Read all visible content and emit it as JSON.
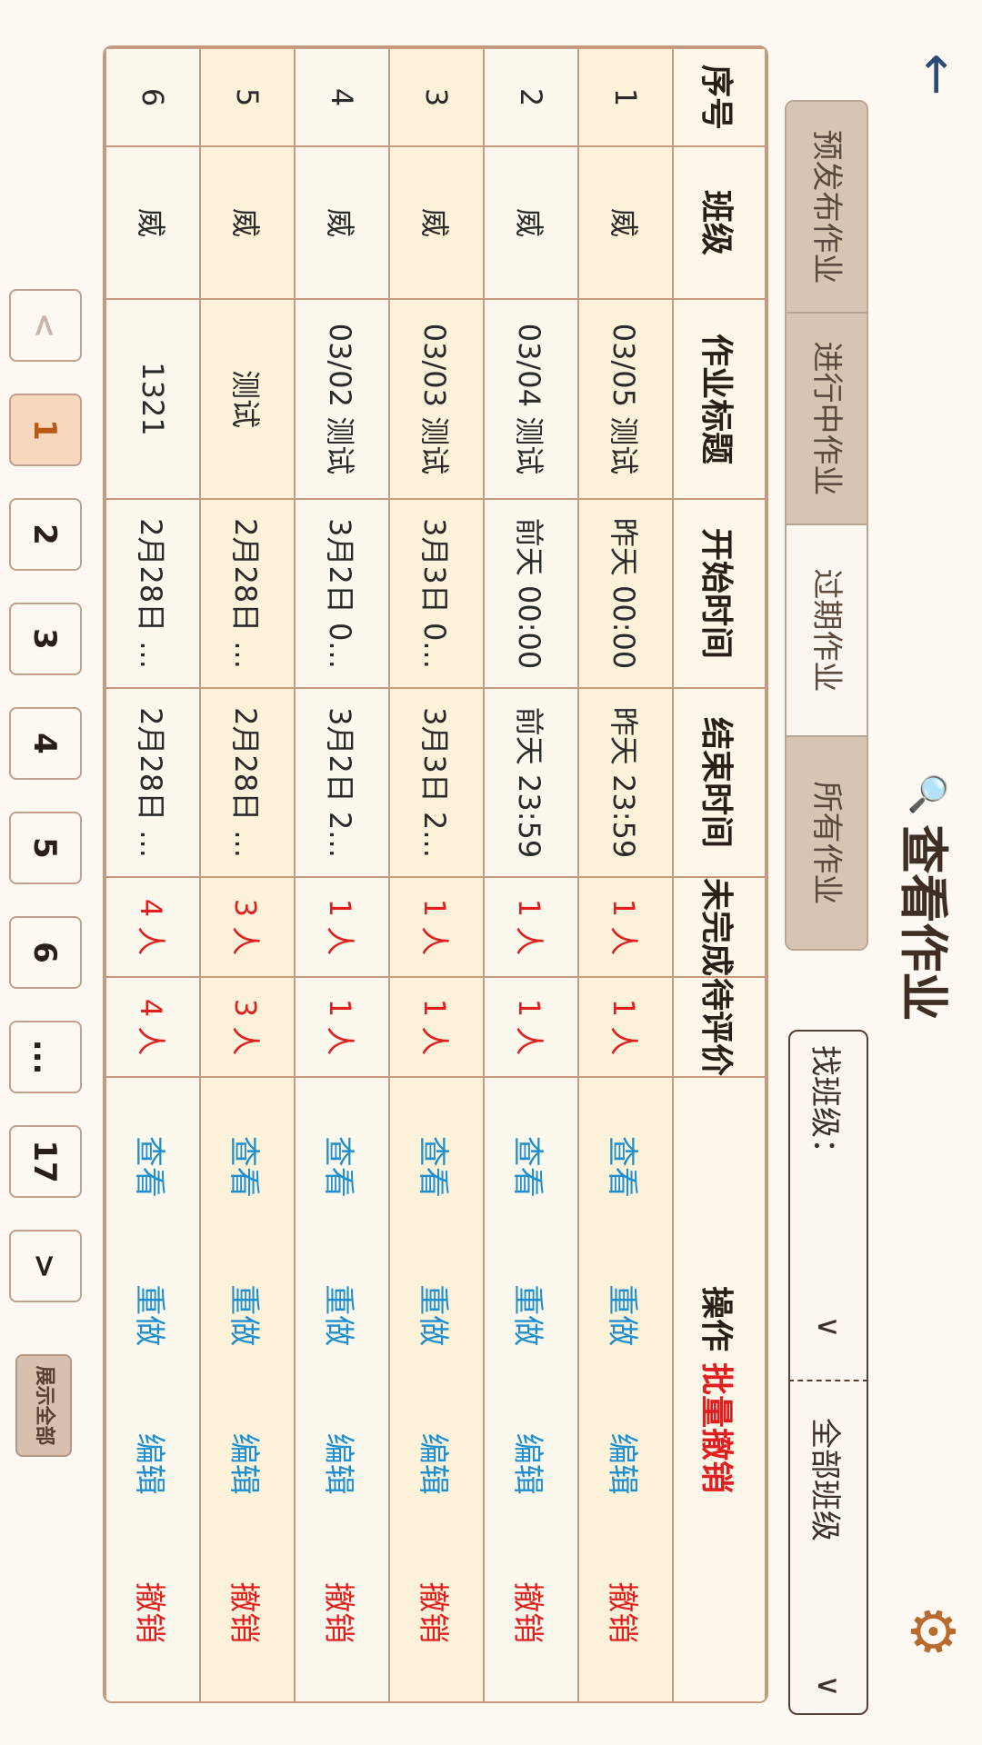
{
  "header": {
    "title": "查看作业",
    "back_icon": "←",
    "search_icon": "🔍",
    "gear_icon": "⚙"
  },
  "tabs": [
    {
      "label": "预发布作业",
      "active": false
    },
    {
      "label": "进行中作业",
      "active": false
    },
    {
      "label": "过期作业",
      "active": true
    },
    {
      "label": "所有作业",
      "active": false
    }
  ],
  "class_filter": {
    "label": "找班级：",
    "chevron": "∨",
    "value": "全部班级",
    "chevron2": "∨"
  },
  "table": {
    "headers": [
      "序号",
      "班级",
      "作业标题",
      "开始时间",
      "结束时间",
      "未完成",
      "待评价",
      "操作"
    ],
    "batch_label": "批量撤销",
    "actions": [
      "查看",
      "重做",
      "编辑",
      "撤销"
    ],
    "rows": [
      [
        "1",
        "威",
        "03/05 测试",
        "昨天 00:00",
        "昨天 23:59",
        "1 人",
        "1 人"
      ],
      [
        "2",
        "威",
        "03/04 测试",
        "前天 00:00",
        "前天 23:59",
        "1 人",
        "1 人"
      ],
      [
        "3",
        "威",
        "03/03 测试",
        "3月3日 0...",
        "3月3日 2...",
        "1 人",
        "1 人"
      ],
      [
        "4",
        "威",
        "03/02 测试",
        "3月2日 0...",
        "3月2日 2...",
        "1 人",
        "1 人"
      ],
      [
        "5",
        "威",
        "测试",
        "2月28日 ...",
        "2月28日 ...",
        "3 人",
        "3 人"
      ],
      [
        "6",
        "威",
        "1321",
        "2月28日 ...",
        "2月28日 ...",
        "4 人",
        "4 人"
      ]
    ]
  },
  "pagination": {
    "prev": "<",
    "pages": [
      "1",
      "2",
      "3",
      "4",
      "5",
      "6",
      "...",
      "17"
    ],
    "active": "1",
    "next": ">"
  },
  "show_all": "展示全部"
}
